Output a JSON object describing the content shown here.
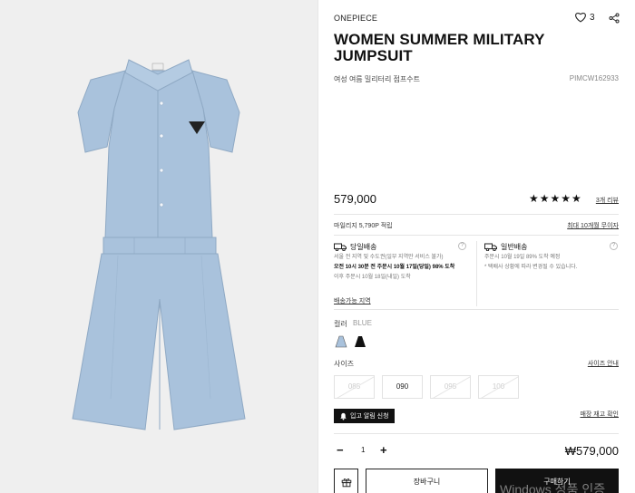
{
  "product": {
    "brand": "ONEPIECE",
    "like_count": "3",
    "title": "WOMEN SUMMER MILITARY JUMPSUIT",
    "korean_name": "여성 여름 밀리터리 점프수트",
    "code": "PIMCW162933",
    "price": "579,000",
    "rating_stars": "★★★★★",
    "rating_fraction": 1.0,
    "reviews_link": "3개 리뷰"
  },
  "benefits": {
    "mileage": "마일리지 5,790P 적립",
    "installment": "최대 10개월 무이자"
  },
  "shipping": {
    "same_day": {
      "label": "당일배송",
      "line1": "서울 전 지역 및 수도권(일부 지역만 서비스 불가)",
      "line2": "오전 10시 30분 전 주문시 10월 17일(당일) 98% 도착",
      "line3": "이후 주문시 10월 18일(내일) 도착"
    },
    "regular": {
      "label": "일반배송",
      "line1": "주문시 10월 19일 89% 도착 예정",
      "line2": "* 택배사 상황에 따라 변경될 수 있습니다."
    },
    "area_link": "배송가능 지역"
  },
  "color": {
    "label": "컬러",
    "selected": "BLUE",
    "swatches": [
      "#a9c2dc",
      "#111111"
    ]
  },
  "size": {
    "label": "사이즈",
    "guide_link": "사이즈 안내",
    "options": [
      {
        "label": "085",
        "sold_out": true
      },
      {
        "label": "090",
        "sold_out": false
      },
      {
        "label": "095",
        "sold_out": true
      },
      {
        "label": "100",
        "sold_out": true
      }
    ]
  },
  "restock": {
    "button": "입고 알림 신청",
    "stock_link": "매장 재고 확인"
  },
  "order": {
    "minus": "−",
    "quantity": "1",
    "plus": "+",
    "total": "₩579,000",
    "cart_button": "장바구니",
    "buy_button": "구매하기",
    "watermark": "Windows 정품 인증"
  },
  "icons": {
    "like": "heart-icon",
    "share": "share-icon",
    "bell": "bell-icon",
    "gift": "gift-icon",
    "truck": "truck-icon",
    "info": "info-icon"
  },
  "colors": {
    "garment": "#a9c2dc",
    "background": "#efefef",
    "accent": "#111111"
  }
}
